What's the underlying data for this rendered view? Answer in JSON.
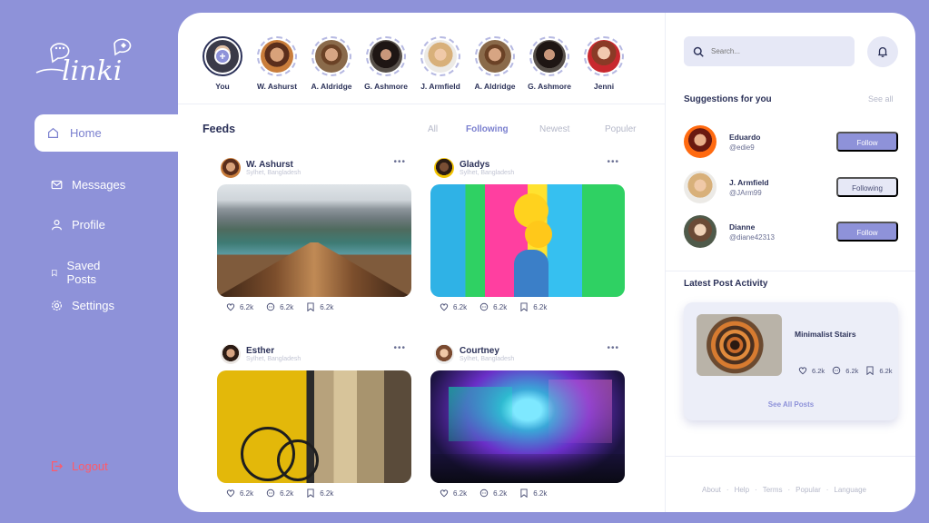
{
  "app": {
    "logo_text": "linki"
  },
  "sidebar": {
    "items": [
      {
        "label": "Home",
        "icon": "home-icon",
        "active": true
      },
      {
        "label": "Messages",
        "icon": "mail-icon"
      },
      {
        "label": "Profile",
        "icon": "user-icon"
      },
      {
        "label": "Saved Posts",
        "icon": "bookmark-icon"
      },
      {
        "label": "Settings",
        "icon": "gear-icon"
      }
    ],
    "logout": "Logout"
  },
  "stories": [
    {
      "name": "You"
    },
    {
      "name": "W. Ashurst"
    },
    {
      "name": "A. Aldridge"
    },
    {
      "name": "G. Ashmore"
    },
    {
      "name": "J. Armfield"
    },
    {
      "name": "A. Aldridge"
    },
    {
      "name": "G. Ashmore"
    },
    {
      "name": "Jenni"
    }
  ],
  "feeds": {
    "title": "Feeds",
    "tabs": [
      "All",
      "Following",
      "Newest",
      "Populer"
    ],
    "active_tab": "Following",
    "posts": [
      {
        "author": "W. Ashurst",
        "location": "Sylhet, Bangladesh",
        "likes": "6.2k",
        "comments": "6.2k",
        "saves": "6.2k"
      },
      {
        "author": "Gladys",
        "location": "Sylhet, Bangladesh",
        "likes": "6.2k",
        "comments": "6.2k",
        "saves": "6.2k"
      },
      {
        "author": "Esther",
        "location": "Sylhet, Bangladesh",
        "likes": "6.2k",
        "comments": "6.2k",
        "saves": "6.2k"
      },
      {
        "author": "Courtney",
        "location": "Sylhet, Bangladesh",
        "likes": "6.2k",
        "comments": "6.2k",
        "saves": "6.2k"
      }
    ]
  },
  "search": {
    "placeholder": "Search..."
  },
  "suggestions": {
    "title": "Suggestions for you",
    "see_all": "See all",
    "users": [
      {
        "name": "Eduardo",
        "handle": "@edie9",
        "button": "Follow"
      },
      {
        "name": "J. Armfield",
        "handle": "@JArm99",
        "button": "Following"
      },
      {
        "name": "Dianne",
        "handle": "@diane42313",
        "button": "Follow"
      }
    ]
  },
  "latest_activity": {
    "title": "Latest Post Activity",
    "post_title": "Minimalist Stairs",
    "likes": "6.2k",
    "comments": "6.2k",
    "saves": "6.2k",
    "link": "See All Posts"
  },
  "footer": {
    "links": [
      "About",
      "Help",
      "Terms",
      "Popular",
      "Language"
    ],
    "separator": "·"
  },
  "colors": {
    "accent": "#8e92d9",
    "text": "#2c3259",
    "logout": "#ff5a6a"
  }
}
